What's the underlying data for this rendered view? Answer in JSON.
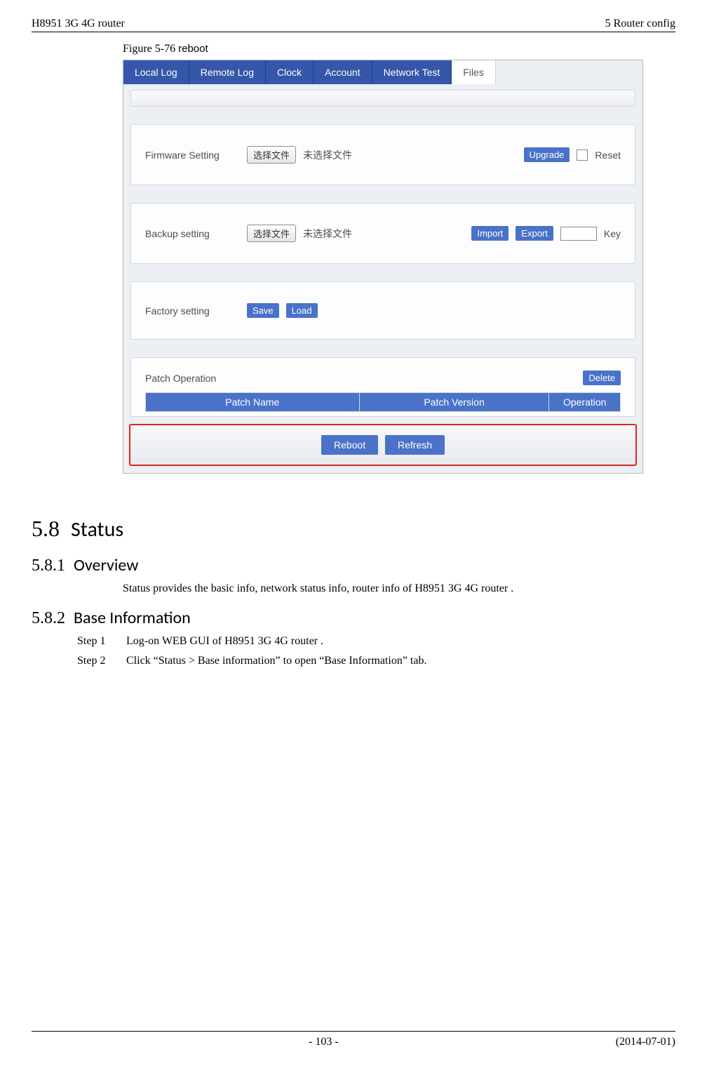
{
  "header": {
    "left": "H8951 3G 4G router",
    "right": "5  Router config"
  },
  "figure": {
    "label": "Figure 5-76  ",
    "title": "reboot"
  },
  "tabs": {
    "local_log": "Local Log",
    "remote_log": "Remote Log",
    "clock": "Clock",
    "account": "Account",
    "network_test": "Network Test",
    "files": "Files"
  },
  "firmware": {
    "label": "Firmware Setting",
    "choose_btn": "选择文件",
    "no_file": "未选择文件",
    "upgrade": "Upgrade",
    "reset": "Reset"
  },
  "backup": {
    "label": "Backup setting",
    "choose_btn": "选择文件",
    "no_file": "未选择文件",
    "import": "Import",
    "export": "Export",
    "key_label": "Key"
  },
  "factory": {
    "label": "Factory setting",
    "save": "Save",
    "load": "Load"
  },
  "patch": {
    "label": "Patch Operation",
    "delete": "Delete",
    "col_name": "Patch Name",
    "col_version": "Patch Version",
    "col_operation": "Operation"
  },
  "buttons": {
    "reboot": "Reboot",
    "refresh": "Refresh"
  },
  "sections": {
    "status_num": "5.8",
    "status_title": "Status",
    "overview_num": "5.8.1",
    "overview_title": "Overview",
    "overview_body": "Status provides the basic info, network status info, router info of H8951 3G 4G router .",
    "baseinfo_num": "5.8.2",
    "baseinfo_title": "Base Information",
    "step1_label": "Step 1",
    "step1_text": "Log-on WEB GUI of H8951 3G 4G router .",
    "step2_label": "Step 2",
    "step2_text": "Click “Status > Base information” to open “Base Information” tab."
  },
  "footer": {
    "page": "- 103 -",
    "date": "(2014-07-01)"
  }
}
